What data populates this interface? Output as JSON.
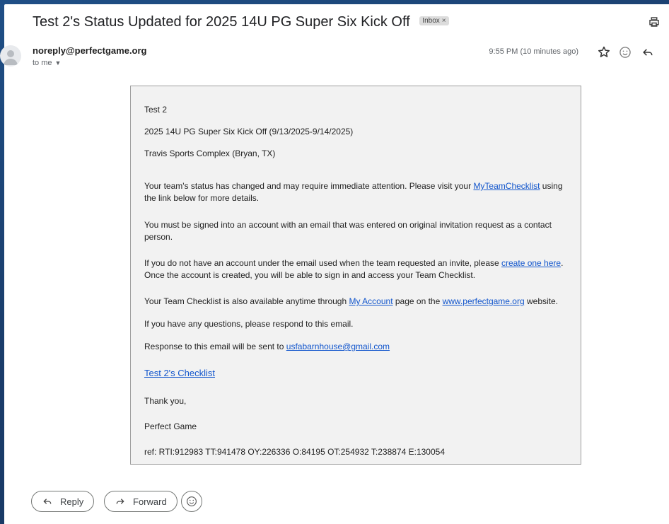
{
  "email": {
    "subject": "Test 2's Status Updated for 2025 14U PG Super Six Kick Off",
    "label": "Inbox",
    "label_close": "×",
    "sender": "noreply@perfectgame.org",
    "recipient": "to me",
    "timestamp": "9:55 PM (10 minutes ago)"
  },
  "body": {
    "team": "Test 2",
    "event": "2025 14U PG Super Six Kick Off (9/13/2025-9/14/2025)",
    "venue": "Travis Sports Complex (Bryan, TX)",
    "p1_pre": "Your team's status has changed and may require immediate attention. Please visit your ",
    "p1_link": "MyTeamChecklist",
    "p1_post": " using the link below for more details.",
    "p2": "You must be signed into an account with an email that was entered on original invitation request as a contact person.",
    "p3_pre": "If you do not have an account under the email used when the team requested an invite, please ",
    "p3_link": "create one here",
    "p3_post": ". Once the account is created, you will be able to sign in and access your Team Checklist.",
    "p4_pre": "Your Team Checklist is also available anytime through ",
    "p4_link1": "My Account",
    "p4_mid": " page on the ",
    "p4_link2": "www.perfectgame.org",
    "p4_post": " website.",
    "p5": "If you have any questions, please respond to this email.",
    "p6_pre": "Response to this email will be sent to ",
    "p6_link": "usfabarnhouse@gmail.com",
    "checklist_link": "Test 2's Checklist",
    "thanks": "Thank you,",
    "signature": "Perfect Game",
    "ref": "ref: RTI:912983 TT:941478 OY:226336 O:84195 OT:254932 T:238874 E:130054"
  },
  "actions": {
    "reply": "Reply",
    "forward": "Forward"
  },
  "icons": [
    "print-icon",
    "star-icon",
    "emoji-icon",
    "reply-icon",
    "forward-icon",
    "chevron-down-icon",
    "avatar-icon"
  ]
}
